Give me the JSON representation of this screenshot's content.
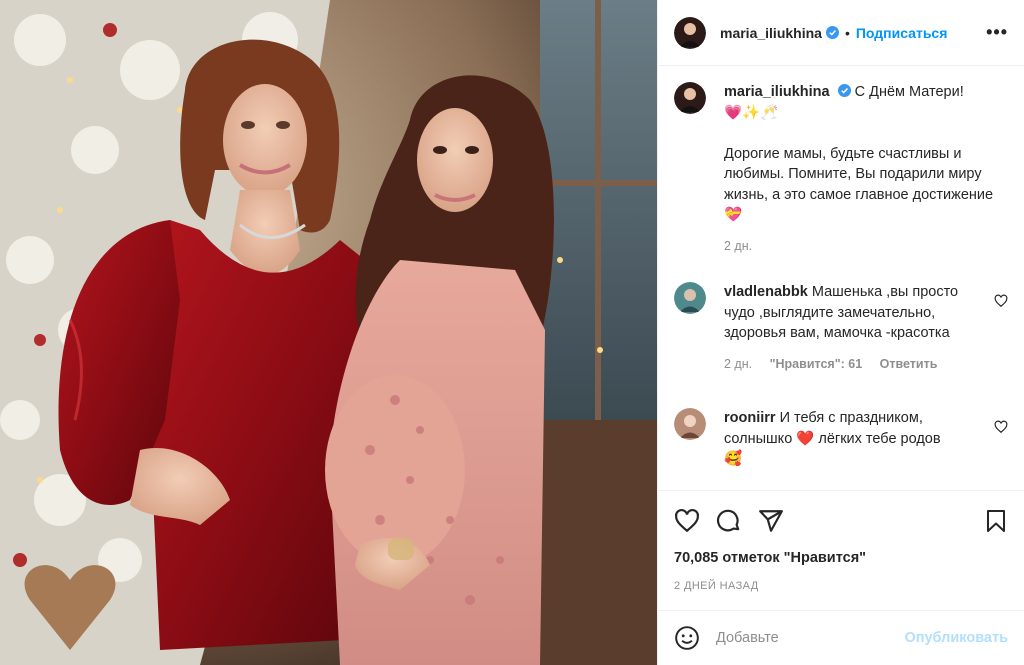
{
  "post": {
    "author": "maria_iliukhina",
    "follow_label": "Подписаться",
    "separator": "•",
    "more_label": "•••"
  },
  "caption": {
    "author": "maria_iliukhina",
    "line1": "С Днём Матери!",
    "emojis1": "💗✨🥂",
    "body": "Дорогие мамы, будьте счастливы и любимы. Помните, Вы подарили миру жизнь, а это самое главное достижение",
    "emoji_end": "💝",
    "age": "2 дн."
  },
  "comments": [
    {
      "user": "vladlenabbk",
      "text": "Машенька ,вы просто чудо ,выглядите замечательно, здоровья вам, мамочка -красотка",
      "age": "2 дн.",
      "likes": "\"Нравится\": 61",
      "reply": "Ответить"
    },
    {
      "user": "rooniirr",
      "text_a": "И тебя с праздником, солнышко",
      "emoji_mid": "❤️",
      "text_b": "лёгких тебе родов",
      "emoji_end": "🥰"
    }
  ],
  "likes_label": "70,085 отметок \"Нравится\"",
  "date_label": "2 ДНЕЙ НАЗАД",
  "add_comment": {
    "placeholder": "Добавьте",
    "publish": "Опубликовать"
  },
  "colors": {
    "accent": "#0095f6",
    "muted": "#8e8e8e",
    "publish_disabled": "#b2dffc"
  },
  "icons": [
    "verified-badge-icon",
    "heart-icon",
    "comment-icon",
    "share-icon",
    "bookmark-icon",
    "emoji-icon",
    "more-icon"
  ]
}
